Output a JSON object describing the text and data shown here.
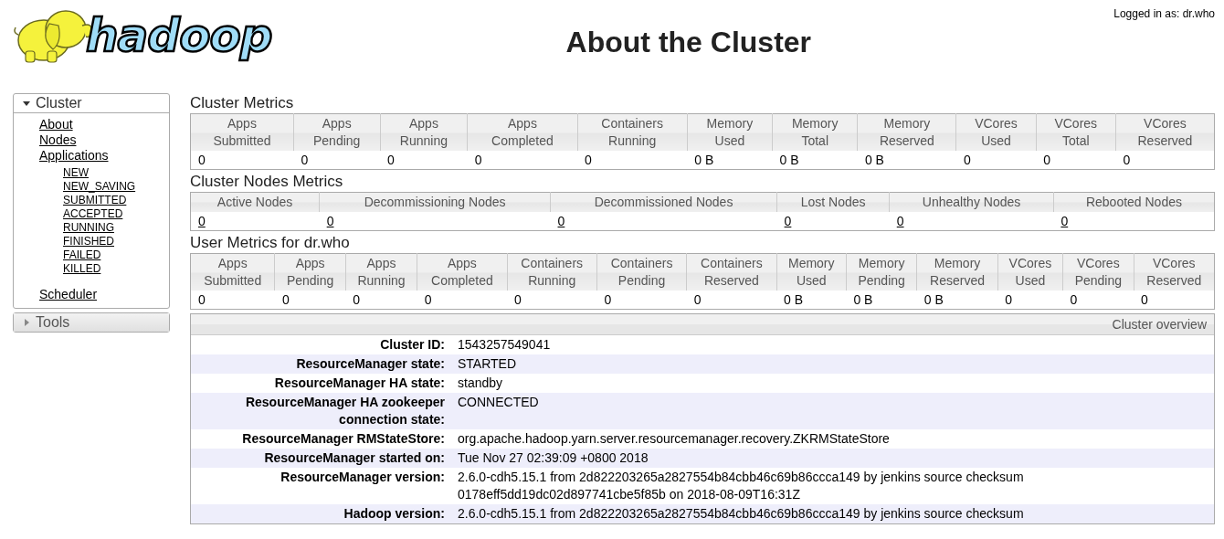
{
  "header": {
    "logo_text": "hadoop",
    "title": "About the Cluster",
    "login": "Logged in as: dr.who"
  },
  "sidebar": [
    {
      "label": "Cluster",
      "expanded": true,
      "items": [
        {
          "label": "About"
        },
        {
          "label": "Nodes"
        },
        {
          "label": "Applications",
          "children": [
            {
              "label": "NEW"
            },
            {
              "label": "NEW_SAVING"
            },
            {
              "label": "SUBMITTED"
            },
            {
              "label": "ACCEPTED"
            },
            {
              "label": "RUNNING"
            },
            {
              "label": "FINISHED"
            },
            {
              "label": "FAILED"
            },
            {
              "label": "KILLED"
            }
          ]
        },
        {
          "label": "Scheduler"
        }
      ]
    },
    {
      "label": "Tools",
      "expanded": false
    }
  ],
  "metrics": [
    {
      "title": "Cluster Metrics",
      "kind": "stacked",
      "values_linked": false,
      "columns": [
        "Apps Submitted",
        "Apps Pending",
        "Apps Running",
        "Apps Completed",
        "Containers Running",
        "Memory Used",
        "Memory Total",
        "Memory Reserved",
        "VCores Used",
        "VCores Total",
        "VCores Reserved"
      ],
      "values": [
        "0",
        "0",
        "0",
        "0",
        "0",
        "0 B",
        "0 B",
        "0 B",
        "0",
        "0",
        "0"
      ]
    },
    {
      "title": "Cluster Nodes Metrics",
      "kind": "flat",
      "values_linked": true,
      "columns": [
        "Active Nodes",
        "Decommissioning Nodes",
        "Decommissioned Nodes",
        "Lost Nodes",
        "Unhealthy Nodes",
        "Rebooted Nodes"
      ],
      "values": [
        "0",
        "0",
        "0",
        "0",
        "0",
        "0"
      ]
    },
    {
      "title": "User Metrics for dr.who",
      "kind": "stacked",
      "values_linked": false,
      "columns": [
        "Apps Submitted",
        "Apps Pending",
        "Apps Running",
        "Apps Completed",
        "Containers Running",
        "Containers Pending",
        "Containers Reserved",
        "Memory Used",
        "Memory Pending",
        "Memory Reserved",
        "VCores Used",
        "VCores Pending",
        "VCores Reserved"
      ],
      "values": [
        "0",
        "0",
        "0",
        "0",
        "0",
        "0",
        "0",
        "0 B",
        "0 B",
        "0 B",
        "0",
        "0",
        "0"
      ]
    }
  ],
  "overview": {
    "caption": "Cluster overview",
    "rows": [
      {
        "label": "Cluster ID:",
        "value": "1543257549041"
      },
      {
        "label": "ResourceManager state:",
        "value": "STARTED"
      },
      {
        "label": "ResourceManager HA state:",
        "value": "standby"
      },
      {
        "label": "ResourceManager HA zookeeper connection state:",
        "value": "CONNECTED"
      },
      {
        "label": "ResourceManager RMStateStore:",
        "value": "org.apache.hadoop.yarn.server.resourcemanager.recovery.ZKRMStateStore"
      },
      {
        "label": "ResourceManager started on:",
        "value": "Tue Nov 27 02:39:09 +0800 2018"
      },
      {
        "label": "ResourceManager version:",
        "value": "2.6.0-cdh5.15.1 from 2d822203265a2827554b84cbb46c69b86ccca149 by jenkins source checksum 0178eff5dd19dc02d897741cbe5f85b on 2018-08-09T16:31Z"
      },
      {
        "label": "Hadoop version:",
        "value": "2.6.0-cdh5.15.1 from 2d822203265a2827554b84cbb46c69b86ccca149 by jenkins source checksum"
      }
    ]
  }
}
